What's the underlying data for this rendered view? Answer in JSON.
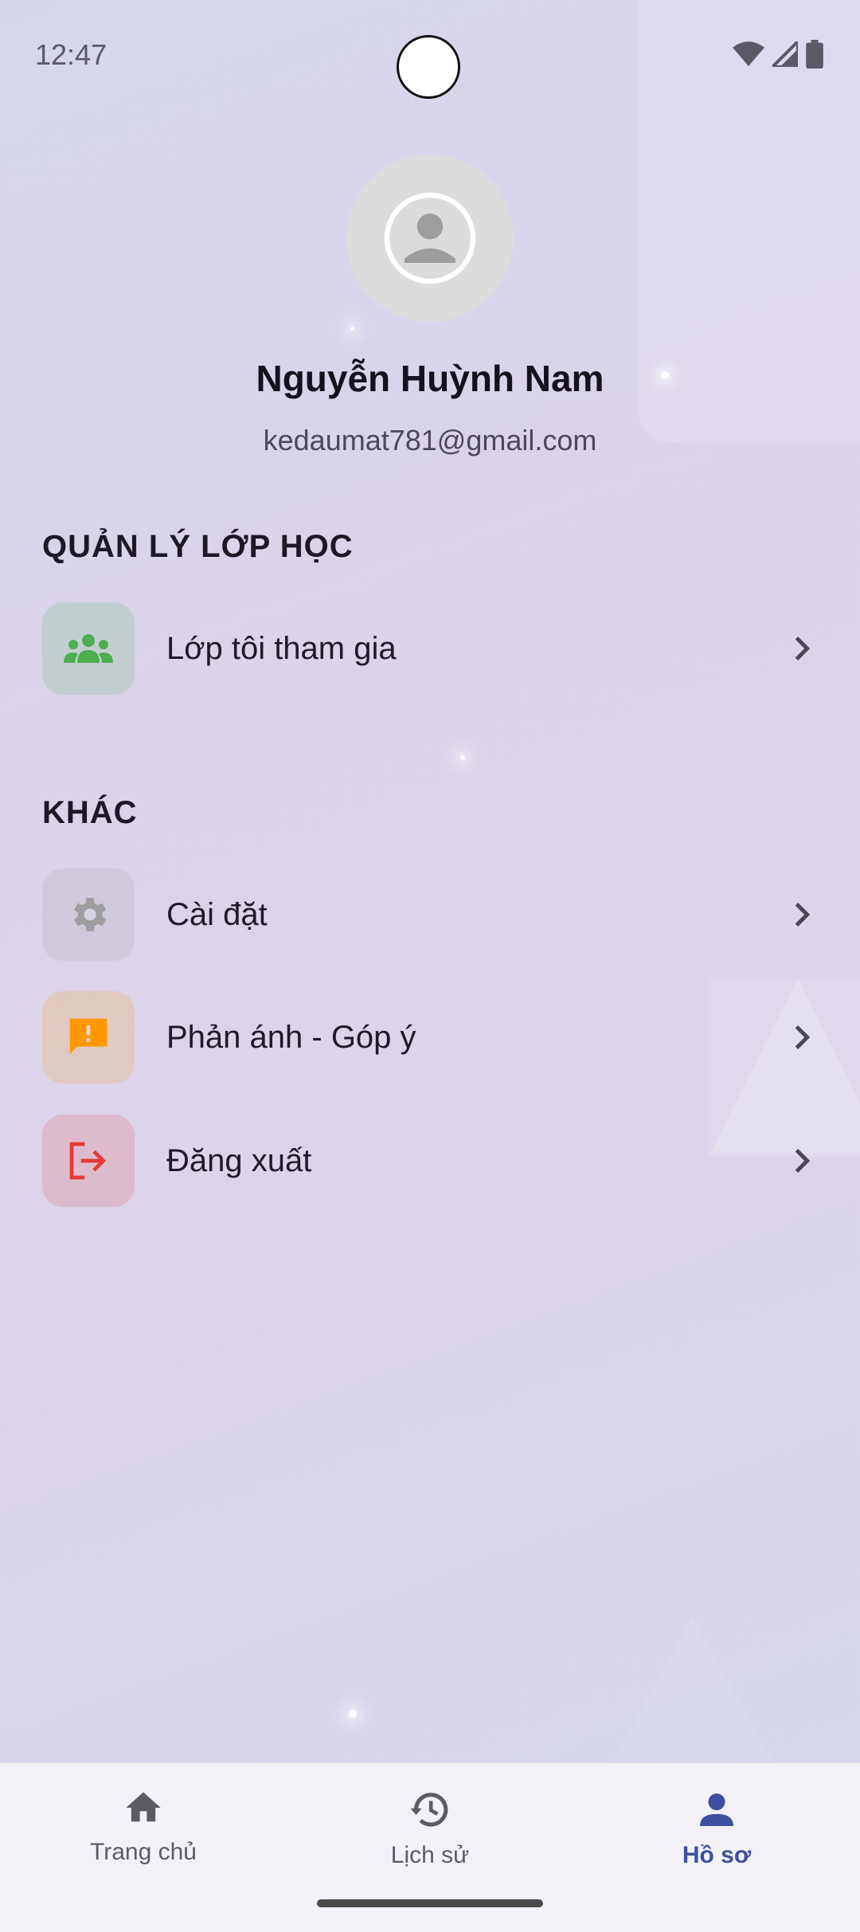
{
  "status_bar": {
    "time": "12:47"
  },
  "profile": {
    "name": "Nguyễn Huỳnh Nam",
    "email": "kedaumat781@gmail.com"
  },
  "sections": {
    "class_management": {
      "title": "QUẢN LÝ LỚP HỌC",
      "items": [
        {
          "label": "Lớp tôi tham gia",
          "icon": "group-icon",
          "color": "#4caf50"
        }
      ]
    },
    "other": {
      "title": "KHÁC",
      "items": [
        {
          "label": "Cài đặt",
          "icon": "gear-icon",
          "color": "#9e9e9e"
        },
        {
          "label": "Phản ánh - Góp ý",
          "icon": "feedback-icon",
          "color": "#ff9800"
        },
        {
          "label": "Đăng xuất",
          "icon": "logout-icon",
          "color": "#e53935"
        }
      ]
    }
  },
  "bottom_nav": {
    "items": [
      {
        "label": "Trang chủ",
        "icon": "home-icon"
      },
      {
        "label": "Lịch sử",
        "icon": "history-icon"
      },
      {
        "label": "Hồ sơ",
        "icon": "person-icon",
        "active": true
      }
    ],
    "active_color": "#3e4fa0"
  }
}
